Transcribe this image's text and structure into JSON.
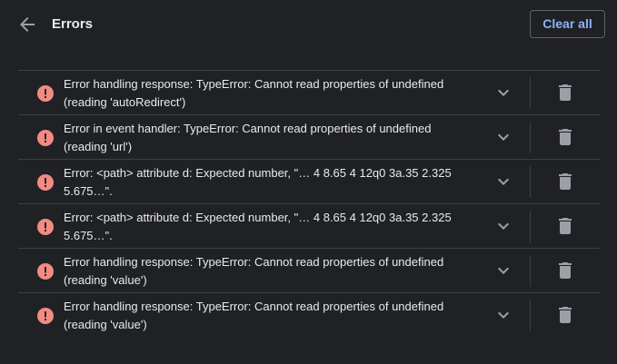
{
  "header": {
    "title": "Errors",
    "clear_all_label": "Clear all"
  },
  "errors": [
    {
      "line1": "Error handling response: TypeError: Cannot read properties of undefined",
      "line2": "(reading 'autoRedirect')"
    },
    {
      "line1": "Error in event handler: TypeError: Cannot read properties of undefined",
      "line2": "(reading 'url')"
    },
    {
      "line1": "Error: <path> attribute d: Expected number, \"… 4 8.65 4 12q0 3a.35 2.325",
      "line2": "5.675…\"."
    },
    {
      "line1": "Error: <path> attribute d: Expected number, \"… 4 8.65 4 12q0 3a.35 2.325",
      "line2": "5.675…\"."
    },
    {
      "line1": "Error handling response: TypeError: Cannot read properties of undefined",
      "line2": "(reading 'value')"
    },
    {
      "line1": "Error handling response: TypeError: Cannot read properties of undefined",
      "line2": "(reading 'value')"
    }
  ],
  "icons": {
    "back": "arrow-back-icon",
    "error": "error-icon",
    "expand": "chevron-down-icon",
    "delete": "trash-icon"
  },
  "colors": {
    "background": "#202124",
    "text": "#e8eaed",
    "accent": "#8ab4f8",
    "error": "#f28b82",
    "icon": "#9aa0a6",
    "divider": "#3c4043"
  }
}
